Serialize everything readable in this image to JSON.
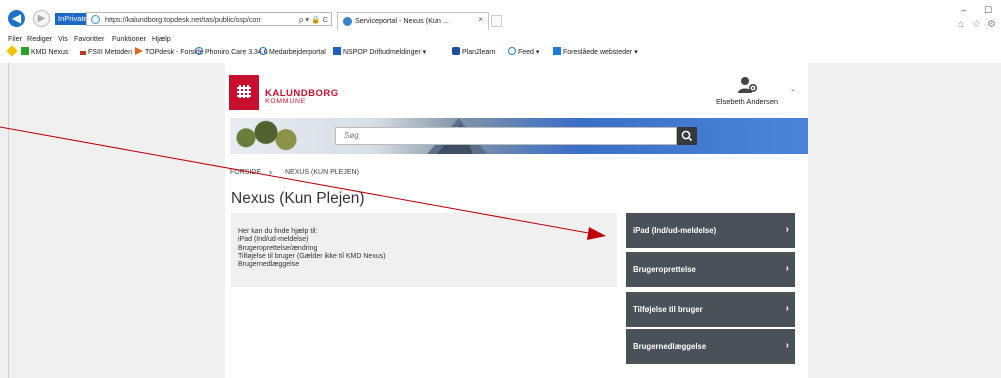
{
  "browser": {
    "inprivate_badge": "InPrivate",
    "url": "https://kalundborg.topdesk.net/tas/public/ssp/content/detail/service?",
    "url_tools": "ρ ▾ 🔒 C",
    "tab_title": "Serviceportal - Nexus (Kun ...",
    "tab_close": "×",
    "menu": [
      "Filer",
      "Rediger",
      "Vis",
      "Favoritter",
      "Funktioner",
      "Hjælp"
    ],
    "favorites": [
      "KMD Nexus",
      "FSIII Metoden",
      "TOPdesk - Forside",
      "Phoniro Care 3.34.6",
      "Medarbejderportal",
      "NSPOP Driftudmeldinger ▾",
      "Plan2learn",
      "Feed ▾",
      "Foreslåede websteder ▾"
    ],
    "window_controls": {
      "minimize": "–",
      "maximize": "☐"
    }
  },
  "header": {
    "logo_name": "KALUNDBORG",
    "logo_sub": "KOMMUNE",
    "user_name": "Elsebeth Andersen",
    "user_caret": "⌄"
  },
  "search": {
    "placeholder": "Søg"
  },
  "breadcrumb": {
    "home": "FORSIDE",
    "separator": "›",
    "current": "NEXUS (KUN PLEJEN)"
  },
  "page_title": "Nexus (Kun Plejen)",
  "info_lines": [
    "Her kan du finde hjælp til:",
    "iPad (Ind/ud-meldelse)",
    "Brugeroprettelse/ændring",
    "Tilføjelse til bruger (Gælder ikke til KMD Nexus)",
    "Brugernedlæggelse"
  ],
  "actions": [
    {
      "label": "iPad (Ind/ud-meldelse)",
      "chevron": "›"
    },
    {
      "label": "Brugeroprettelse",
      "chevron": "›"
    },
    {
      "label": "Tilføjelse til bruger",
      "chevron": "›"
    },
    {
      "label": "Brugernedlæggelse",
      "chevron": "›"
    }
  ],
  "colors": {
    "brand_red": "#c8102e",
    "button_bg": "#4a5158",
    "annotation_red": "#c00000"
  }
}
